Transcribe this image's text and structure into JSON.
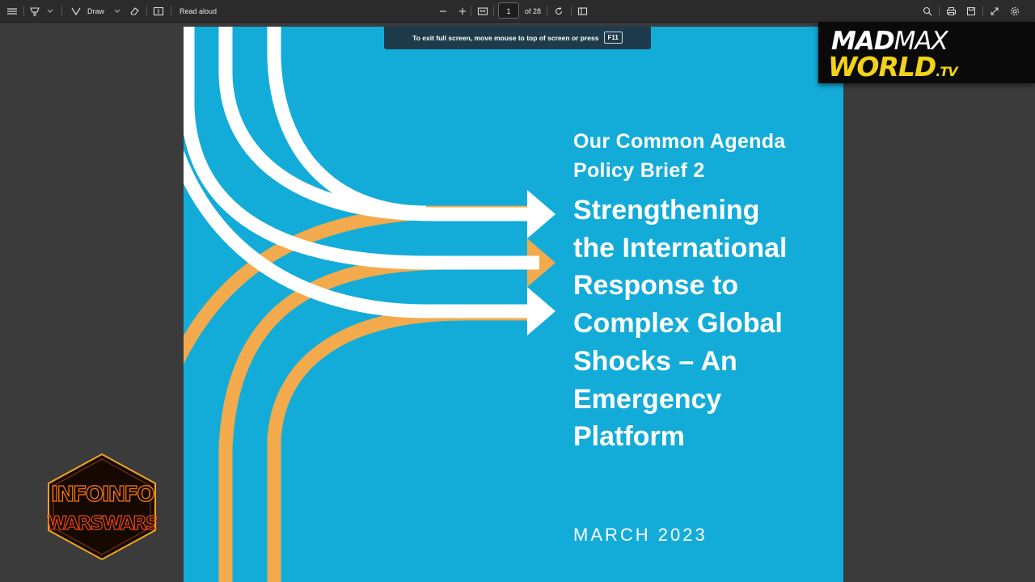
{
  "toolbar": {
    "draw_label": "Draw",
    "read_aloud_label": "Read aloud",
    "page_number": "1",
    "page_total": "of 28"
  },
  "fullscreen_tip": {
    "message": "To exit full screen, move mouse to top of screen or press",
    "key": "F11"
  },
  "document": {
    "series": "Our Common Agenda",
    "brief": "Policy Brief 2",
    "title_lines": [
      "Strengthening",
      "the International",
      "Response to",
      "Complex Global",
      "Shocks – An",
      "Emergency",
      "Platform"
    ],
    "date": "MARCH 2023",
    "colors": {
      "background": "#13acd9",
      "white_stripe": "#ffffff",
      "orange_stripe": "#f3aa4c"
    }
  },
  "overlays": {
    "madmax": {
      "part1": "MAD",
      "part2": "MAX",
      "part3": "WORLD",
      "part4": ".TV"
    },
    "infowars": {
      "row1": "INFOINFO",
      "row2": "WARSWARS"
    }
  }
}
